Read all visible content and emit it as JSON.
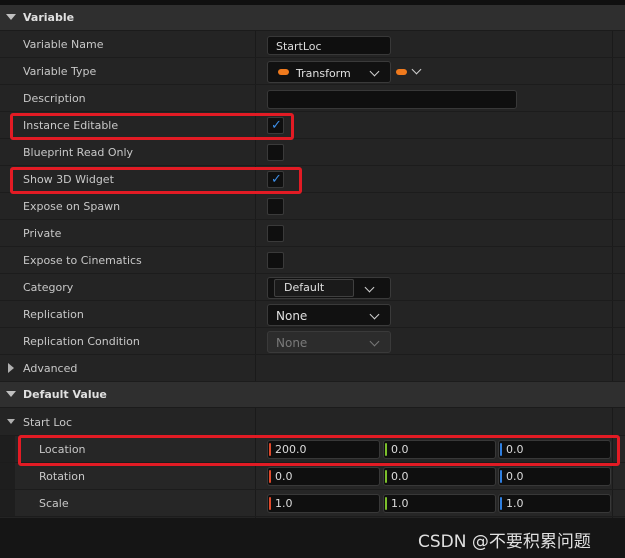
{
  "sections": {
    "variable": "Variable",
    "default_value": "Default Value"
  },
  "rows": {
    "variable_name": {
      "label": "Variable Name",
      "value": "StartLoc"
    },
    "variable_type": {
      "label": "Variable Type",
      "value": "Transform"
    },
    "description": {
      "label": "Description",
      "value": ""
    },
    "instance_editable": {
      "label": "Instance Editable",
      "checked": true
    },
    "blueprint_read_only": {
      "label": "Blueprint Read Only",
      "checked": false
    },
    "show_3d_widget": {
      "label": "Show 3D Widget",
      "checked": true
    },
    "expose_on_spawn": {
      "label": "Expose on Spawn",
      "checked": false
    },
    "private": {
      "label": "Private",
      "checked": false
    },
    "expose_to_cinematics": {
      "label": "Expose to Cinematics",
      "checked": false
    },
    "category": {
      "label": "Category",
      "value": "Default"
    },
    "replication": {
      "label": "Replication",
      "value": "None"
    },
    "replication_condition": {
      "label": "Replication Condition",
      "value": "None"
    },
    "advanced": {
      "label": "Advanced"
    }
  },
  "default_value": {
    "group_label": "Start Loc",
    "location": {
      "label": "Location",
      "x": "200.0",
      "y": "0.0",
      "z": "0.0"
    },
    "rotation": {
      "label": "Rotation",
      "x": "0.0",
      "y": "0.0",
      "z": "0.0"
    },
    "scale": {
      "label": "Scale",
      "x": "1.0",
      "y": "1.0",
      "z": "1.0"
    }
  },
  "colors": {
    "accent_check": "#3d8ee8",
    "type_pill": "#f07a1d",
    "axis_x": "#e0492b",
    "axis_y": "#7cc02b",
    "axis_z": "#2f7fe0",
    "highlight": "#e21b24"
  },
  "watermark": "CSDN @不要积累问题"
}
